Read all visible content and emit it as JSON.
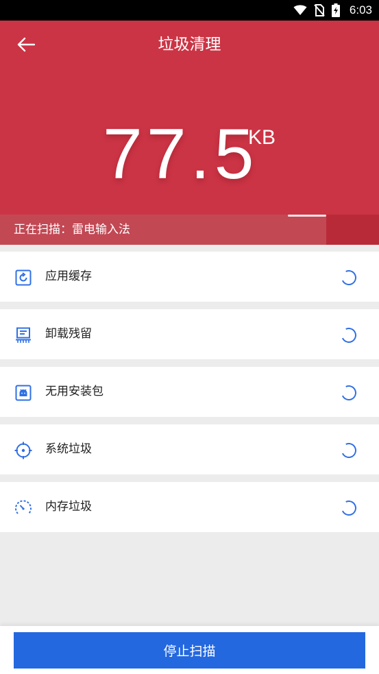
{
  "status_bar": {
    "time": "6:03",
    "icons": [
      "wifi-icon",
      "no-sim-icon",
      "battery-charging-icon"
    ]
  },
  "header": {
    "title": "垃圾清理",
    "back_icon": "arrow-left-icon",
    "background_color": "#cb3445"
  },
  "scan": {
    "size_value": "77.5",
    "size_unit": "KB",
    "status_text": "正在扫描：雷电输入法",
    "progress_fraction": 0.86
  },
  "categories": [
    {
      "label": "应用缓存",
      "icon": "app-cache-icon",
      "status": "scanning"
    },
    {
      "label": "卸载残留",
      "icon": "uninstall-residue-icon",
      "status": "scanning"
    },
    {
      "label": "无用安装包",
      "icon": "apk-package-icon",
      "status": "scanning"
    },
    {
      "label": "系统垃圾",
      "icon": "system-junk-icon",
      "status": "scanning"
    },
    {
      "label": "内存垃圾",
      "icon": "memory-gauge-icon",
      "status": "scanning"
    }
  ],
  "footer": {
    "stop_label": "停止扫描",
    "button_color": "#2468df"
  },
  "accent_color": "#2f6fe6"
}
